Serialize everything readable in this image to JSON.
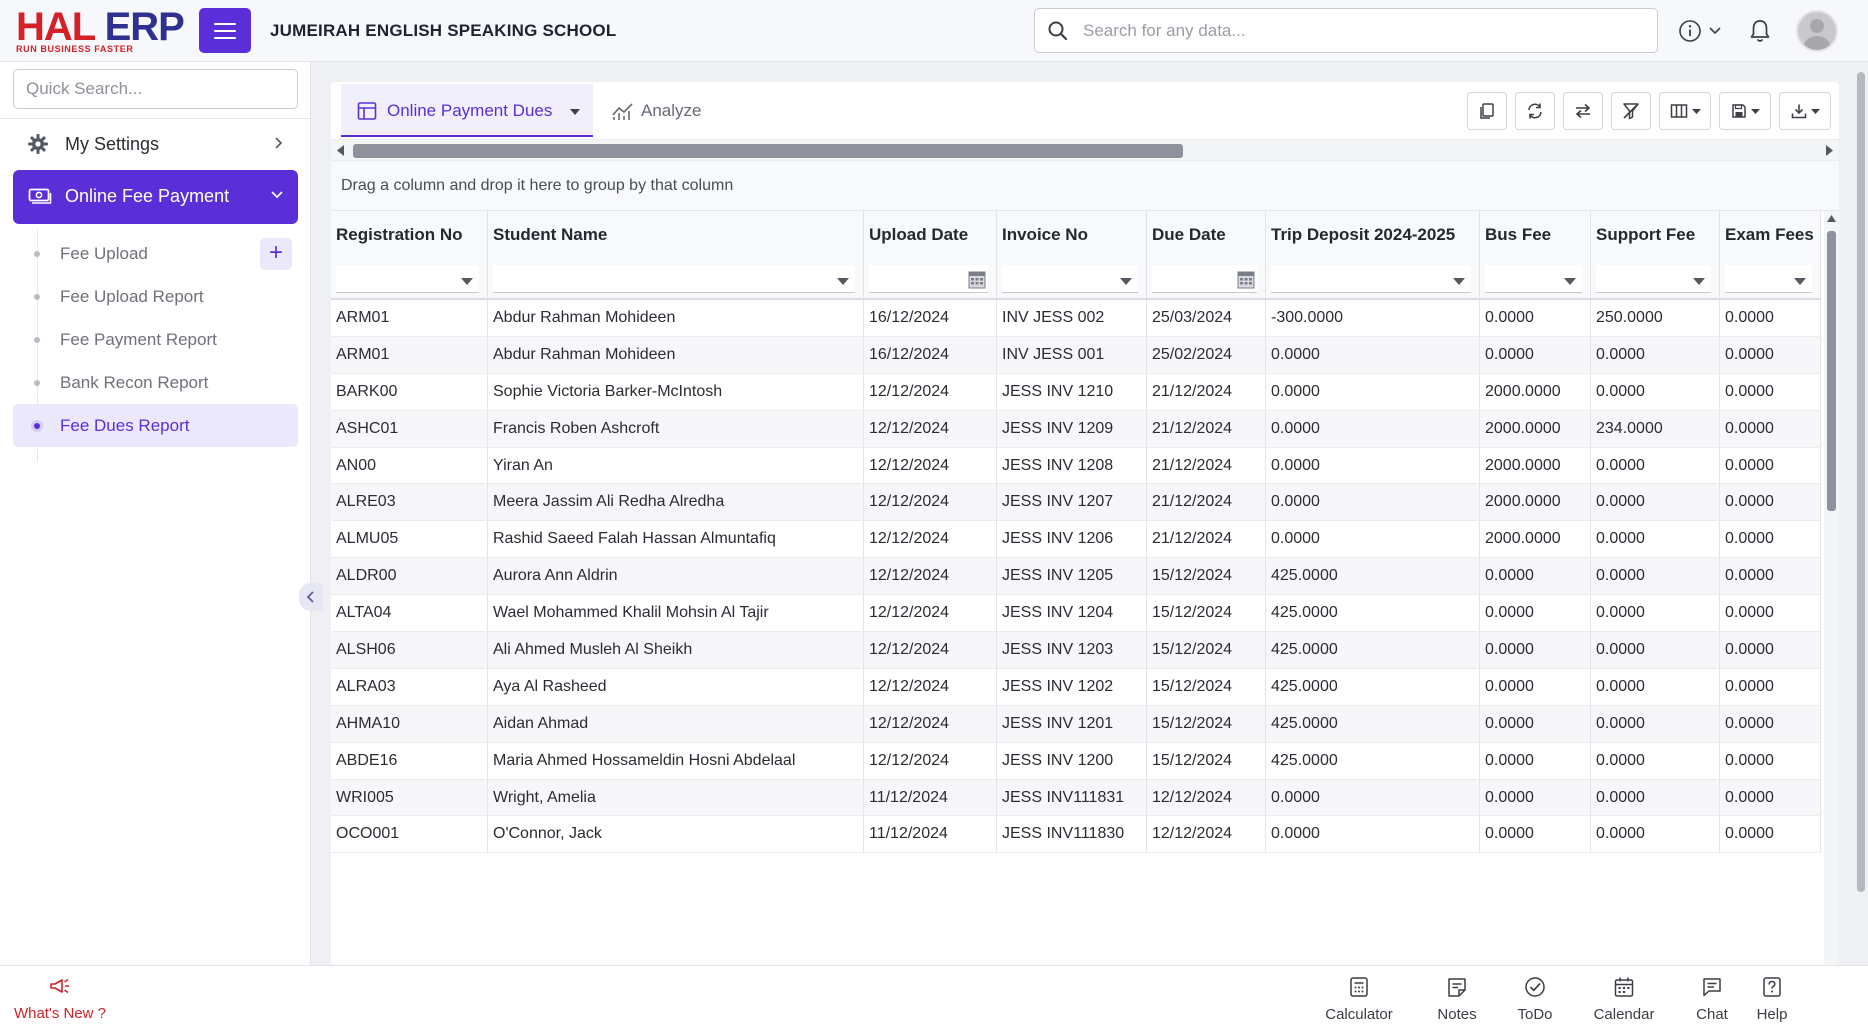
{
  "app": {
    "logo_main_1": "HAL",
    "logo_main_2": "ERP",
    "logo_tagline": "RUN BUSINESS FASTER",
    "school_name": "JUMEIRAH ENGLISH SPEAKING SCHOOL"
  },
  "search": {
    "placeholder": "Search for any data..."
  },
  "sidebar": {
    "quick_search_placeholder": "Quick Search...",
    "settings_label": "My Settings",
    "active_section_label": "Online Fee Payment",
    "items": [
      {
        "label": "Fee Upload"
      },
      {
        "label": "Fee Upload Report"
      },
      {
        "label": "Fee Payment Report"
      },
      {
        "label": "Bank Recon Report"
      },
      {
        "label": "Fee Dues Report"
      }
    ]
  },
  "tabs": {
    "active": "Online Payment Dues",
    "analyze": "Analyze"
  },
  "grid": {
    "group_hint": "Drag a column and drop it here to group by that column",
    "columns": [
      "Registration No",
      "Student Name",
      "Upload Date",
      "Invoice No",
      "Due Date",
      "Trip Deposit 2024-2025",
      "Bus Fee",
      "Support Fee",
      "Exam Fees"
    ],
    "rows": [
      [
        "ARM01",
        "Abdur Rahman Mohideen",
        "16/12/2024",
        "INV JESS 002",
        "25/03/2024",
        "-300.0000",
        "0.0000",
        "250.0000",
        "0.0000"
      ],
      [
        "ARM01",
        "Abdur Rahman Mohideen",
        "16/12/2024",
        "INV JESS 001",
        "25/02/2024",
        "0.0000",
        "0.0000",
        "0.0000",
        "0.0000"
      ],
      [
        "BARK00",
        "Sophie Victoria Barker-McIntosh",
        "12/12/2024",
        "JESS INV 1210",
        "21/12/2024",
        "0.0000",
        "2000.0000",
        "0.0000",
        "0.0000"
      ],
      [
        "ASHC01",
        "Francis Roben Ashcroft",
        "12/12/2024",
        "JESS INV 1209",
        "21/12/2024",
        "0.0000",
        "2000.0000",
        "234.0000",
        "0.0000"
      ],
      [
        "AN00",
        "Yiran An",
        "12/12/2024",
        "JESS INV 1208",
        "21/12/2024",
        "0.0000",
        "2000.0000",
        "0.0000",
        "0.0000"
      ],
      [
        "ALRE03",
        "Meera Jassim Ali Redha Alredha",
        "12/12/2024",
        "JESS INV 1207",
        "21/12/2024",
        "0.0000",
        "2000.0000",
        "0.0000",
        "0.0000"
      ],
      [
        "ALMU05",
        "Rashid Saeed Falah Hassan Almuntafiq",
        "12/12/2024",
        "JESS INV 1206",
        "21/12/2024",
        "0.0000",
        "2000.0000",
        "0.0000",
        "0.0000"
      ],
      [
        "ALDR00",
        "Aurora Ann Aldrin",
        "12/12/2024",
        "JESS INV 1205",
        "15/12/2024",
        "425.0000",
        "0.0000",
        "0.0000",
        "0.0000"
      ],
      [
        "ALTA04",
        "Wael Mohammed Khalil Mohsin Al Tajir",
        "12/12/2024",
        "JESS INV 1204",
        "15/12/2024",
        "425.0000",
        "0.0000",
        "0.0000",
        "0.0000"
      ],
      [
        "ALSH06",
        "Ali Ahmed Musleh Al Sheikh",
        "12/12/2024",
        "JESS INV 1203",
        "15/12/2024",
        "425.0000",
        "0.0000",
        "0.0000",
        "0.0000"
      ],
      [
        "ALRA03",
        "Aya Al Rasheed",
        "12/12/2024",
        "JESS INV 1202",
        "15/12/2024",
        "425.0000",
        "0.0000",
        "0.0000",
        "0.0000"
      ],
      [
        "AHMA10",
        "Aidan Ahmad",
        "12/12/2024",
        "JESS INV 1201",
        "15/12/2024",
        "425.0000",
        "0.0000",
        "0.0000",
        "0.0000"
      ],
      [
        "ABDE16",
        "Maria Ahmed Hossameldin Hosni Abdelaal",
        "12/12/2024",
        "JESS INV 1200",
        "15/12/2024",
        "425.0000",
        "0.0000",
        "0.0000",
        "0.0000"
      ],
      [
        "WRI005",
        "Wright, Amelia",
        "11/12/2024",
        "JESS INV111831",
        "12/12/2024",
        "0.0000",
        "0.0000",
        "0.0000",
        "0.0000"
      ],
      [
        "OCO001",
        "O'Connor, Jack",
        "11/12/2024",
        "JESS INV111830",
        "12/12/2024",
        "0.0000",
        "0.0000",
        "0.0000",
        "0.0000"
      ]
    ]
  },
  "footer": {
    "whats_new": "What's New ?",
    "items": [
      {
        "label": "Calculator",
        "icon": "calculator-icon"
      },
      {
        "label": "Notes",
        "icon": "notes-icon"
      },
      {
        "label": "ToDo",
        "icon": "todo-icon"
      },
      {
        "label": "Calendar",
        "icon": "calendar-icon"
      },
      {
        "label": "Chat",
        "icon": "chat-icon"
      },
      {
        "label": "Help",
        "icon": "help-icon"
      }
    ]
  },
  "colors": {
    "accent": "#5b2fd8",
    "brand_red": "#d42027",
    "brand_navy": "#2e3192"
  }
}
